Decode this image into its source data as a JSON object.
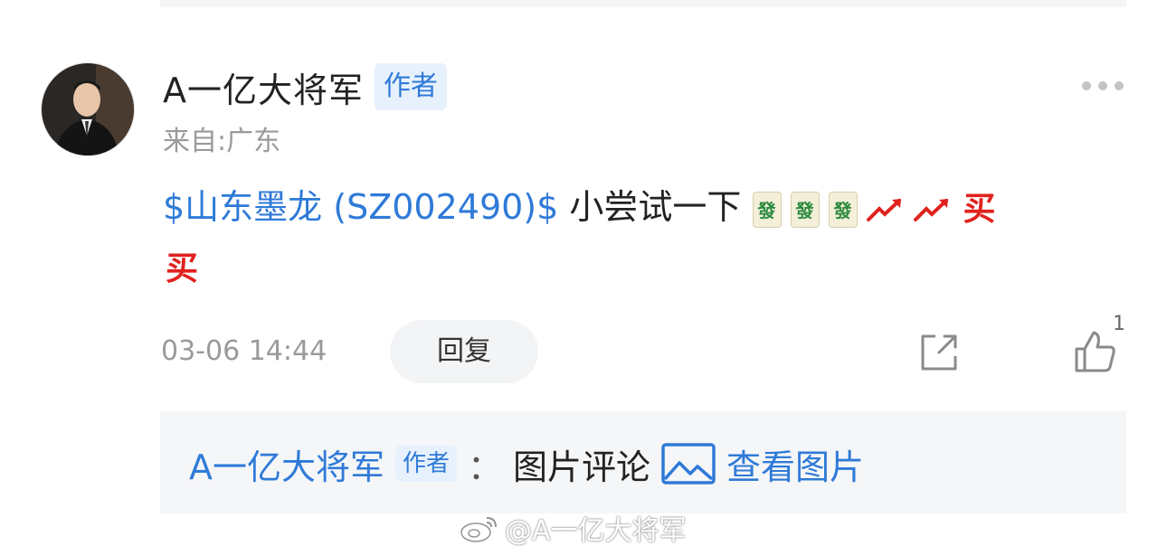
{
  "comment": {
    "username": "A一亿大将军",
    "author_badge": "作者",
    "location": "来自:广东",
    "stock_link": "$山东墨龙 (SZ002490)$",
    "text": " 小尝试一下",
    "emoji_tile": "發",
    "emoji_buy": "买",
    "timestamp": "03-06 14:44",
    "reply_label": "回复",
    "like_count": "1"
  },
  "reply_preview": {
    "username": "A一亿大将军",
    "author_badge": "作者",
    "colon": "：",
    "text": "图片评论",
    "view_image": "查看图片"
  },
  "watermark": {
    "text": "@A一亿大将军"
  },
  "colors": {
    "link": "#2f7ad8",
    "badge_bg": "#e7f1fd",
    "muted": "#9a9a9a",
    "panel_bg": "#f5f6f8"
  },
  "icons": [
    "more-icon",
    "share-icon",
    "like-icon",
    "image-icon",
    "weibo-logo-icon"
  ]
}
